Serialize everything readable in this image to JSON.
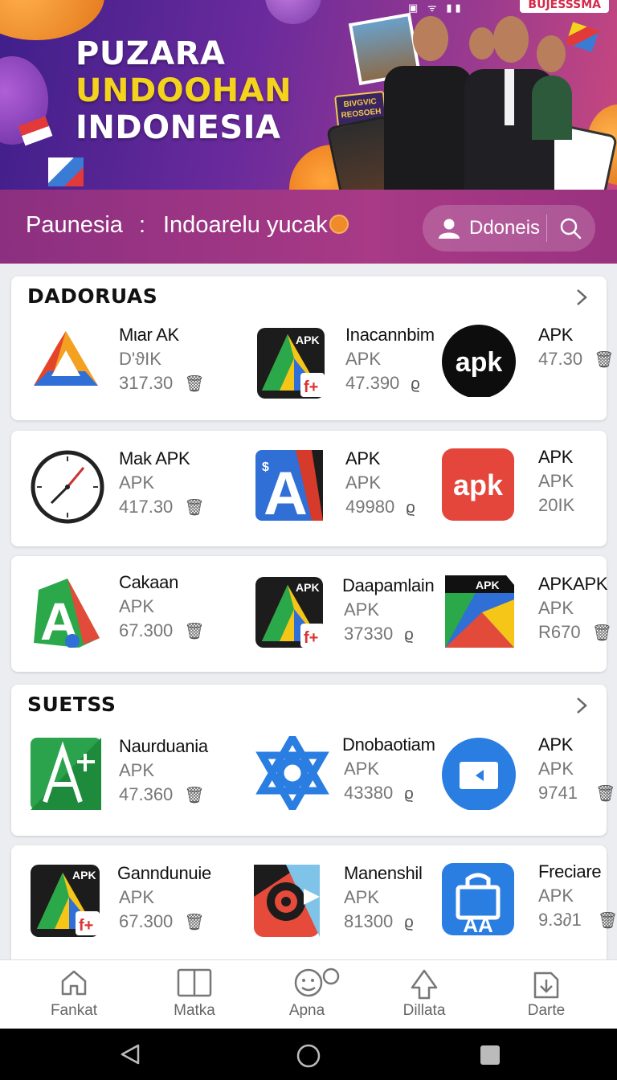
{
  "banner": {
    "title_line1": "PUZARA",
    "title_line2": "UNDOOHAN",
    "title_line3": "INDONESIA",
    "corner_badge": "BUJESSSMA",
    "promo_card": "BIVGVIC REOSOEH",
    "title_color": "#ffffff",
    "highlight_color": "#f4d31c"
  },
  "header": {
    "left_label": "Paunesia",
    "separator": ":",
    "subtitle": "Indoarelu yucak",
    "pill_label": "Ddoneis",
    "background": "#9a3280"
  },
  "sections": [
    {
      "title": "DADORUAS",
      "rows": [
        [
          {
            "name": "Mιar AK",
            "sub": "D'ϑIK",
            "meta": "317.30",
            "icon": "tri-drive-icon"
          },
          {
            "name": "Inacannbim",
            "sub": "APK",
            "meta": "47.390",
            "icon": "apk-dark-icon"
          },
          {
            "name": "APK",
            "sub": "47.30",
            "meta": "",
            "icon": "apk-black-circle-icon",
            "icon_text": "apk"
          }
        ]
      ]
    },
    {
      "title": "",
      "rows": [
        [
          {
            "name": "Mak APK",
            "sub": "APK",
            "meta": "417.30",
            "icon": "clock-icon"
          },
          {
            "name": "APK",
            "sub": "APK",
            "meta": "49980",
            "icon": "blue-a-icon"
          },
          {
            "name": "APK",
            "sub": "APK",
            "meta": "20IK",
            "icon": "apk-red-icon",
            "icon_text": "apk"
          }
        ]
      ]
    },
    {
      "title": "",
      "rows": [
        [
          {
            "name": "Cakaan",
            "sub": "APK",
            "meta": "67.300",
            "icon": "green-a-icon"
          },
          {
            "name": "Daapamlain",
            "sub": "APK",
            "meta": "37330",
            "icon": "apk-dark-icon"
          },
          {
            "name": "APKAPK",
            "sub": "APK",
            "meta": "R670",
            "icon": "play-store-icon"
          }
        ]
      ]
    },
    {
      "title": "SUETSS",
      "rows": [
        [
          {
            "name": "Naurduania",
            "sub": "APK",
            "meta": "47.360",
            "icon": "green-ruler-icon"
          },
          {
            "name": "Dnobaotiam",
            "sub": "APK",
            "meta": "43380",
            "icon": "blue-star-icon"
          },
          {
            "name": "APK",
            "sub": "APK",
            "meta": "9741",
            "icon": "blue-circle-icon"
          }
        ]
      ]
    },
    {
      "title": "",
      "rows": [
        [
          {
            "name": "Ganndunuie",
            "sub": "APK",
            "meta": "67.300",
            "icon": "apk-dark-icon"
          },
          {
            "name": "Manenshil",
            "sub": "APK",
            "meta": "81300",
            "icon": "record-icon"
          },
          {
            "name": "Freciare",
            "sub": "APK",
            "meta": "9.3∂1",
            "icon": "bag-icon"
          }
        ]
      ]
    }
  ],
  "tabs": [
    {
      "label": "Fankat",
      "icon": "home-icon"
    },
    {
      "label": "Matka",
      "icon": "book-icon"
    },
    {
      "label": "Apna",
      "icon": "face-icon"
    },
    {
      "label": "Dillata",
      "icon": "arrow-up-icon"
    },
    {
      "label": "Darte",
      "icon": "download-icon"
    }
  ],
  "system_nav": {
    "back": "back-icon",
    "home": "home-circle-icon",
    "recents": "recents-icon"
  }
}
